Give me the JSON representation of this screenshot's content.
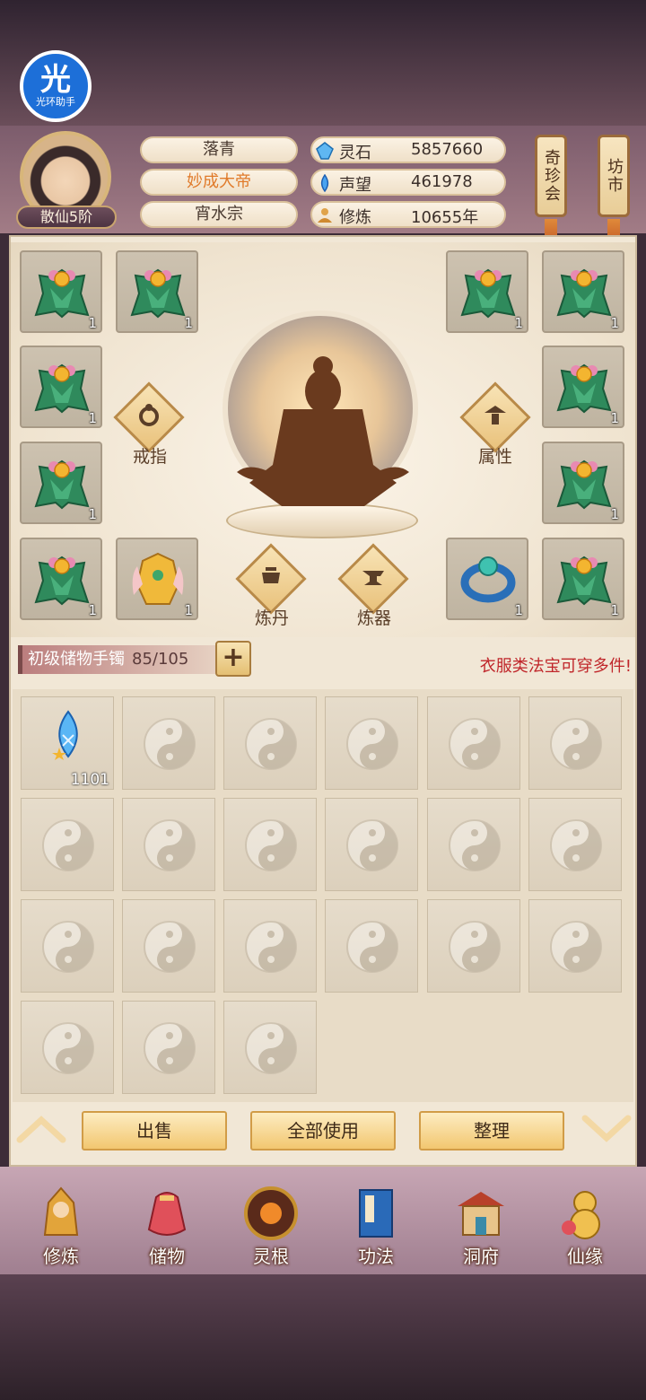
{
  "helper_badge": {
    "big": "光",
    "small": "光环助手"
  },
  "player": {
    "rank": "散仙5阶",
    "name": "落青",
    "title": "妙成大帝",
    "sect": "宵水宗"
  },
  "resources": [
    {
      "label": "灵石",
      "value": "5857660",
      "icon": "spirit-stone-icon"
    },
    {
      "label": "声望",
      "value": "461978",
      "icon": "reputation-icon"
    },
    {
      "label": "修炼",
      "value": "10655年",
      "icon": "cultivation-icon"
    }
  ],
  "top_buttons": {
    "treasure_fair": "奇珍会",
    "market": "坊市"
  },
  "equipment": {
    "slot_count": "1",
    "ring_label": "戒指",
    "attributes_label": "属性",
    "alchemy_label": "炼丹",
    "forge_label": "炼器"
  },
  "bag": {
    "name": "初级储物手镯",
    "capacity": "85/105",
    "add_label": "+",
    "tip": "衣服类法宝可穿多件!",
    "first_item_count": "1101"
  },
  "actions": {
    "sell": "出售",
    "use_all": "全部使用",
    "sort": "整理"
  },
  "nav": [
    {
      "label": "修炼",
      "icon": "cultivate-icon"
    },
    {
      "label": "储物",
      "icon": "storage-bag-icon"
    },
    {
      "label": "灵根",
      "icon": "spirit-root-icon"
    },
    {
      "label": "功法",
      "icon": "technique-book-icon"
    },
    {
      "label": "洞府",
      "icon": "cave-abode-icon"
    },
    {
      "label": "仙缘",
      "icon": "immortal-fate-icon"
    }
  ],
  "colors": {
    "accent_gold": "#f2c770",
    "warning_red": "#c0262a",
    "title_orange": "#e07a2a"
  }
}
